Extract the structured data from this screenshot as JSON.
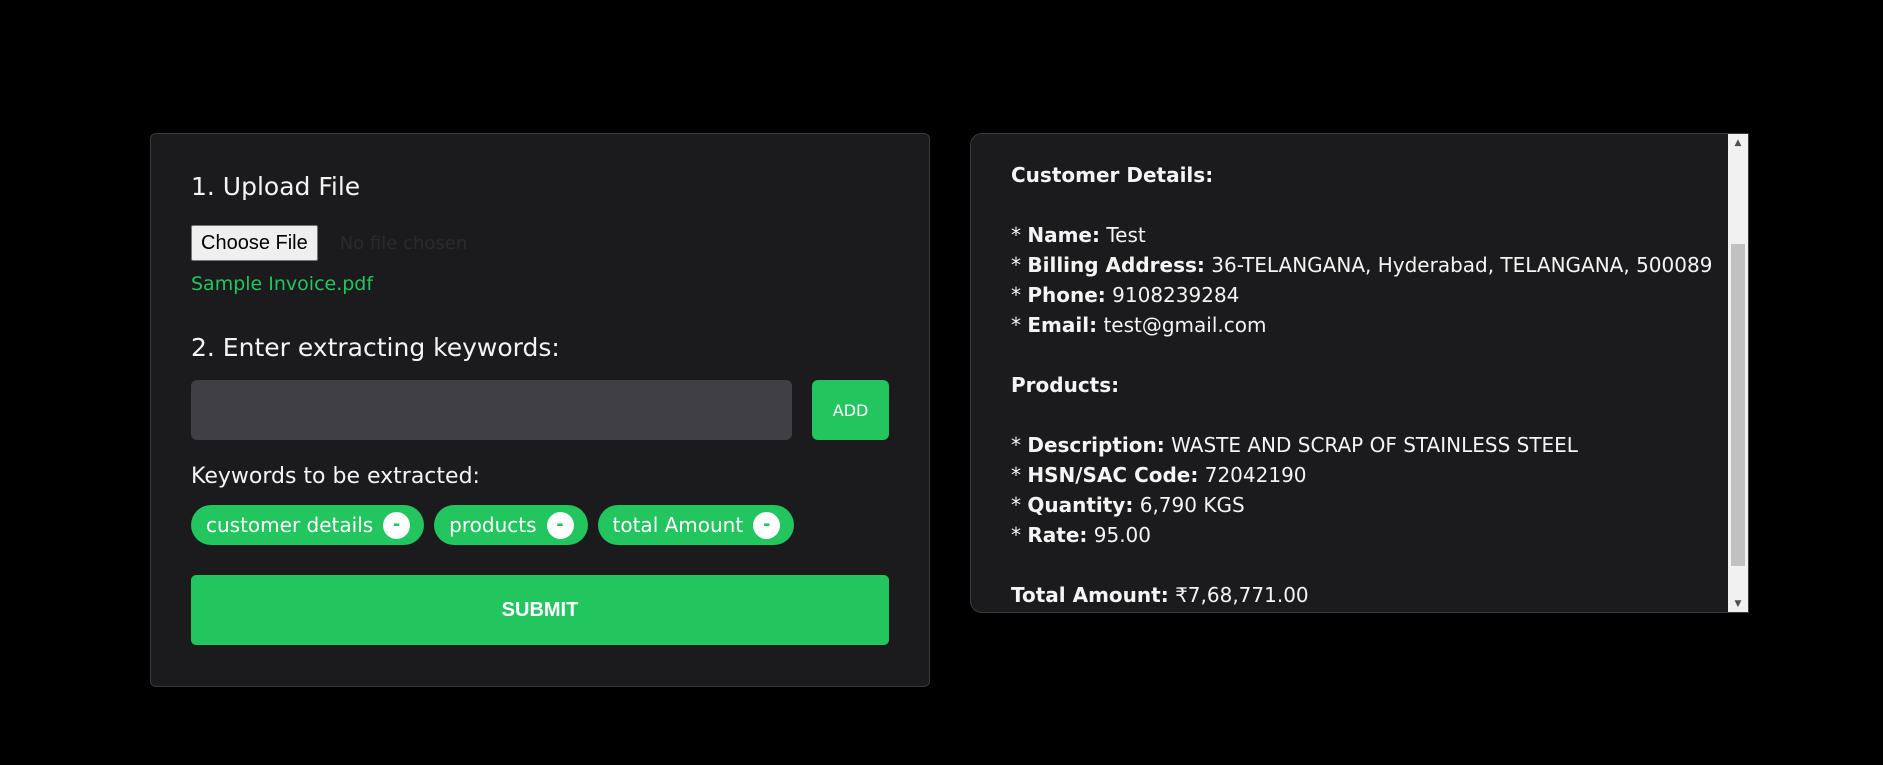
{
  "upload": {
    "title": "1. Upload File",
    "choose_label": "Choose File",
    "status_text": "No file chosen",
    "file_name": "Sample Invoice.pdf"
  },
  "keywords": {
    "title": "2. Enter extracting keywords:",
    "input_value": "",
    "input_placeholder": "",
    "add_label": "ADD",
    "list_label": "Keywords to be extracted:",
    "chips": [
      {
        "label": "customer details",
        "remove": "-"
      },
      {
        "label": "products",
        "remove": "-"
      },
      {
        "label": "total Amount",
        "remove": "-"
      }
    ],
    "submit_label": "SUBMIT"
  },
  "result": {
    "customer_heading": "Customer Details:",
    "name_label": "Name:",
    "name_value": "Test",
    "billing_label": "Billing Address:",
    "billing_value": "36-TELANGANA, Hyderabad, TELANGANA, 500089",
    "phone_label": "Phone:",
    "phone_value": "9108239284",
    "email_label": "Email:",
    "email_value": "test@gmail.com",
    "products_heading": "Products:",
    "desc_label": "Description:",
    "desc_value": "WASTE AND SCRAP OF STAINLESS STEEL",
    "hsn_label": "HSN/SAC Code:",
    "hsn_value": "72042190",
    "qty_label": "Quantity:",
    "qty_value": "6,790 KGS",
    "rate_label": "Rate:",
    "rate_value": "95.00",
    "total_label": "Total Amount:",
    "total_value": "₹7,68,771.00",
    "bullet": "* "
  },
  "colors": {
    "accent": "#22c55e",
    "panel_bg": "#1b1b1d",
    "page_bg": "#000000",
    "input_bg": "#3f3f44"
  },
  "icons": {
    "scroll_up": "triangle-up-icon",
    "scroll_down": "triangle-down-icon"
  }
}
